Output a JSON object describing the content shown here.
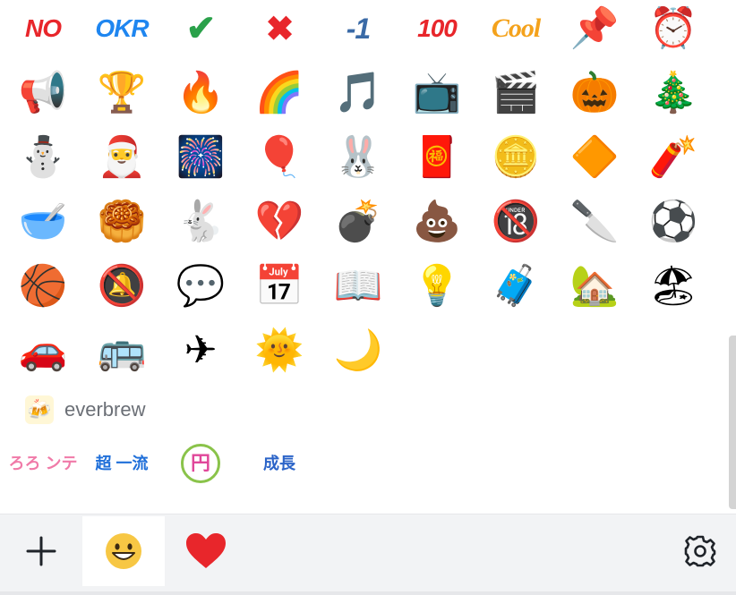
{
  "emoji_grid": [
    {
      "name": "no-sticker",
      "glyph": "NO",
      "kind": "text",
      "cls": "no"
    },
    {
      "name": "okr-sticker",
      "glyph": "OKR",
      "kind": "text",
      "cls": "okr"
    },
    {
      "name": "checkmark-sticker",
      "glyph": "✔",
      "kind": "text",
      "cls": "check"
    },
    {
      "name": "cross-sticker",
      "glyph": "✖",
      "kind": "text",
      "cls": "cross"
    },
    {
      "name": "minus-one-sticker",
      "glyph": "-1",
      "kind": "text",
      "cls": "minus1"
    },
    {
      "name": "hundred-sticker",
      "glyph": "100",
      "kind": "text",
      "cls": "hundred"
    },
    {
      "name": "cool-sticker",
      "glyph": "Cool",
      "kind": "text",
      "cls": "cool"
    },
    {
      "name": "pushpin-emoji",
      "glyph": "📌",
      "kind": "emoji"
    },
    {
      "name": "alarm-clock-emoji",
      "glyph": "⏰",
      "kind": "emoji"
    },
    {
      "name": "megaphone-emoji",
      "glyph": "📢",
      "kind": "emoji"
    },
    {
      "name": "trophy-emoji",
      "glyph": "🏆",
      "kind": "emoji"
    },
    {
      "name": "fire-emoji",
      "glyph": "🔥",
      "kind": "emoji"
    },
    {
      "name": "rainbow-emoji",
      "glyph": "🌈",
      "kind": "emoji"
    },
    {
      "name": "music-note-emoji",
      "glyph": "🎵",
      "kind": "emoji"
    },
    {
      "name": "television-emoji",
      "glyph": "📺",
      "kind": "emoji"
    },
    {
      "name": "clapper-board-emoji",
      "glyph": "🎬",
      "kind": "emoji"
    },
    {
      "name": "jack-o-lantern-emoji",
      "glyph": "🎃",
      "kind": "emoji"
    },
    {
      "name": "christmas-tree-emoji",
      "glyph": "🎄",
      "kind": "emoji"
    },
    {
      "name": "snowman-emoji",
      "glyph": "⛄",
      "kind": "emoji"
    },
    {
      "name": "santa-hat-emoji",
      "glyph": "🎅",
      "kind": "emoji"
    },
    {
      "name": "fireworks-emoji",
      "glyph": "🎆",
      "kind": "emoji"
    },
    {
      "name": "year-2023-sticker",
      "glyph": "🎈",
      "kind": "emoji"
    },
    {
      "name": "rabbit-sticker",
      "glyph": "🐰",
      "kind": "emoji"
    },
    {
      "name": "red-envelope-emoji",
      "glyph": "🧧",
      "kind": "emoji"
    },
    {
      "name": "coins-emoji",
      "glyph": "🪙",
      "kind": "emoji"
    },
    {
      "name": "fu-blessing-emoji",
      "glyph": "🔶",
      "kind": "emoji"
    },
    {
      "name": "firecracker-emoji",
      "glyph": "🧨",
      "kind": "emoji"
    },
    {
      "name": "rice-bowl-emoji",
      "glyph": "🥣",
      "kind": "emoji"
    },
    {
      "name": "mooncake-emoji",
      "glyph": "🥮",
      "kind": "emoji"
    },
    {
      "name": "moon-rabbit-emoji",
      "glyph": "🐇",
      "kind": "emoji"
    },
    {
      "name": "broken-heart-emoji",
      "glyph": "💔",
      "kind": "emoji"
    },
    {
      "name": "bomb-emoji",
      "glyph": "💣",
      "kind": "emoji"
    },
    {
      "name": "poop-emoji",
      "glyph": "💩",
      "kind": "emoji"
    },
    {
      "name": "no-under-18-emoji",
      "glyph": "🔞",
      "kind": "emoji"
    },
    {
      "name": "kitchen-knife-emoji",
      "glyph": "🔪",
      "kind": "emoji"
    },
    {
      "name": "soccer-ball-emoji",
      "glyph": "⚽",
      "kind": "emoji"
    },
    {
      "name": "basketball-emoji",
      "glyph": "🏀",
      "kind": "emoji"
    },
    {
      "name": "bell-muted-emoji",
      "glyph": "🔕",
      "kind": "emoji"
    },
    {
      "name": "speech-bubble-emoji",
      "glyph": "💬",
      "kind": "emoji"
    },
    {
      "name": "calendar-emoji",
      "glyph": "📅",
      "kind": "emoji"
    },
    {
      "name": "open-book-emoji",
      "glyph": "📖",
      "kind": "emoji"
    },
    {
      "name": "light-bulb-emoji",
      "glyph": "💡",
      "kind": "emoji"
    },
    {
      "name": "luggage-emoji",
      "glyph": "🧳",
      "kind": "emoji"
    },
    {
      "name": "house-emoji",
      "glyph": "🏡",
      "kind": "emoji"
    },
    {
      "name": "beach-umbrella-emoji",
      "glyph": "🏖",
      "kind": "emoji"
    },
    {
      "name": "car-emoji",
      "glyph": "🚗",
      "kind": "emoji"
    },
    {
      "name": "bus-emoji",
      "glyph": "🚌",
      "kind": "emoji"
    },
    {
      "name": "airplane-emoji",
      "glyph": "✈",
      "kind": "emoji"
    },
    {
      "name": "sun-face-emoji",
      "glyph": "🌞",
      "kind": "emoji"
    },
    {
      "name": "moon-night-emoji",
      "glyph": "🌙",
      "kind": "emoji"
    }
  ],
  "custom_section": {
    "icon_glyph": "🍻",
    "label": "everbrew",
    "stickers": [
      {
        "name": "custom-sticker-furisute",
        "text": "ろろ ンテ",
        "cls": "a"
      },
      {
        "name": "custom-sticker-choitchiryu",
        "text": "超 一流",
        "cls": "b"
      },
      {
        "name": "custom-sticker-yen",
        "text": "円",
        "cls": "c"
      },
      {
        "name": "custom-sticker-seichou",
        "text": "成長",
        "cls": "d"
      }
    ]
  },
  "toolbar": {
    "tabs": [
      "add",
      "emoji",
      "favorites",
      "settings"
    ],
    "accent_color": "#e8262b",
    "emoji_tab_bg": "#ffffff"
  }
}
